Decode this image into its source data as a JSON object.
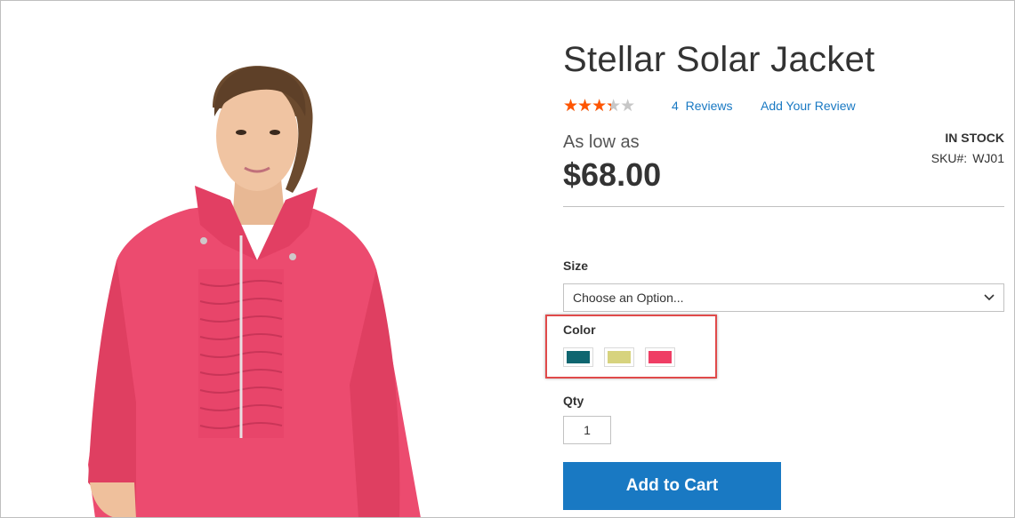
{
  "product": {
    "title": "Stellar Solar Jacket",
    "rating_fraction": 0.6,
    "reviews_count": "4",
    "reviews_label": "Reviews",
    "add_review_label": "Add Your Review",
    "price_prefix": "As low as",
    "price": "$68.00",
    "stock": "IN STOCK",
    "sku_label": "SKU#:",
    "sku_value": "WJ01"
  },
  "options": {
    "size_label": "Size",
    "size_selected": "Choose an Option...",
    "color_label": "Color",
    "colors": [
      {
        "name": "teal-swatch",
        "hex": "#0f6670"
      },
      {
        "name": "yellow-swatch",
        "hex": "#d7d37e"
      },
      {
        "name": "pink-swatch",
        "hex": "#ef3e64"
      }
    ],
    "qty_label": "Qty",
    "qty_value": "1"
  },
  "actions": {
    "add_to_cart": "Add to Cart"
  },
  "colors": {
    "accent": "#1979c3",
    "star": "#ff5501",
    "highlight": "#e04a4a",
    "product": "#ec4b6f"
  },
  "icons": {
    "select_chevron": "chevron-down-icon"
  }
}
